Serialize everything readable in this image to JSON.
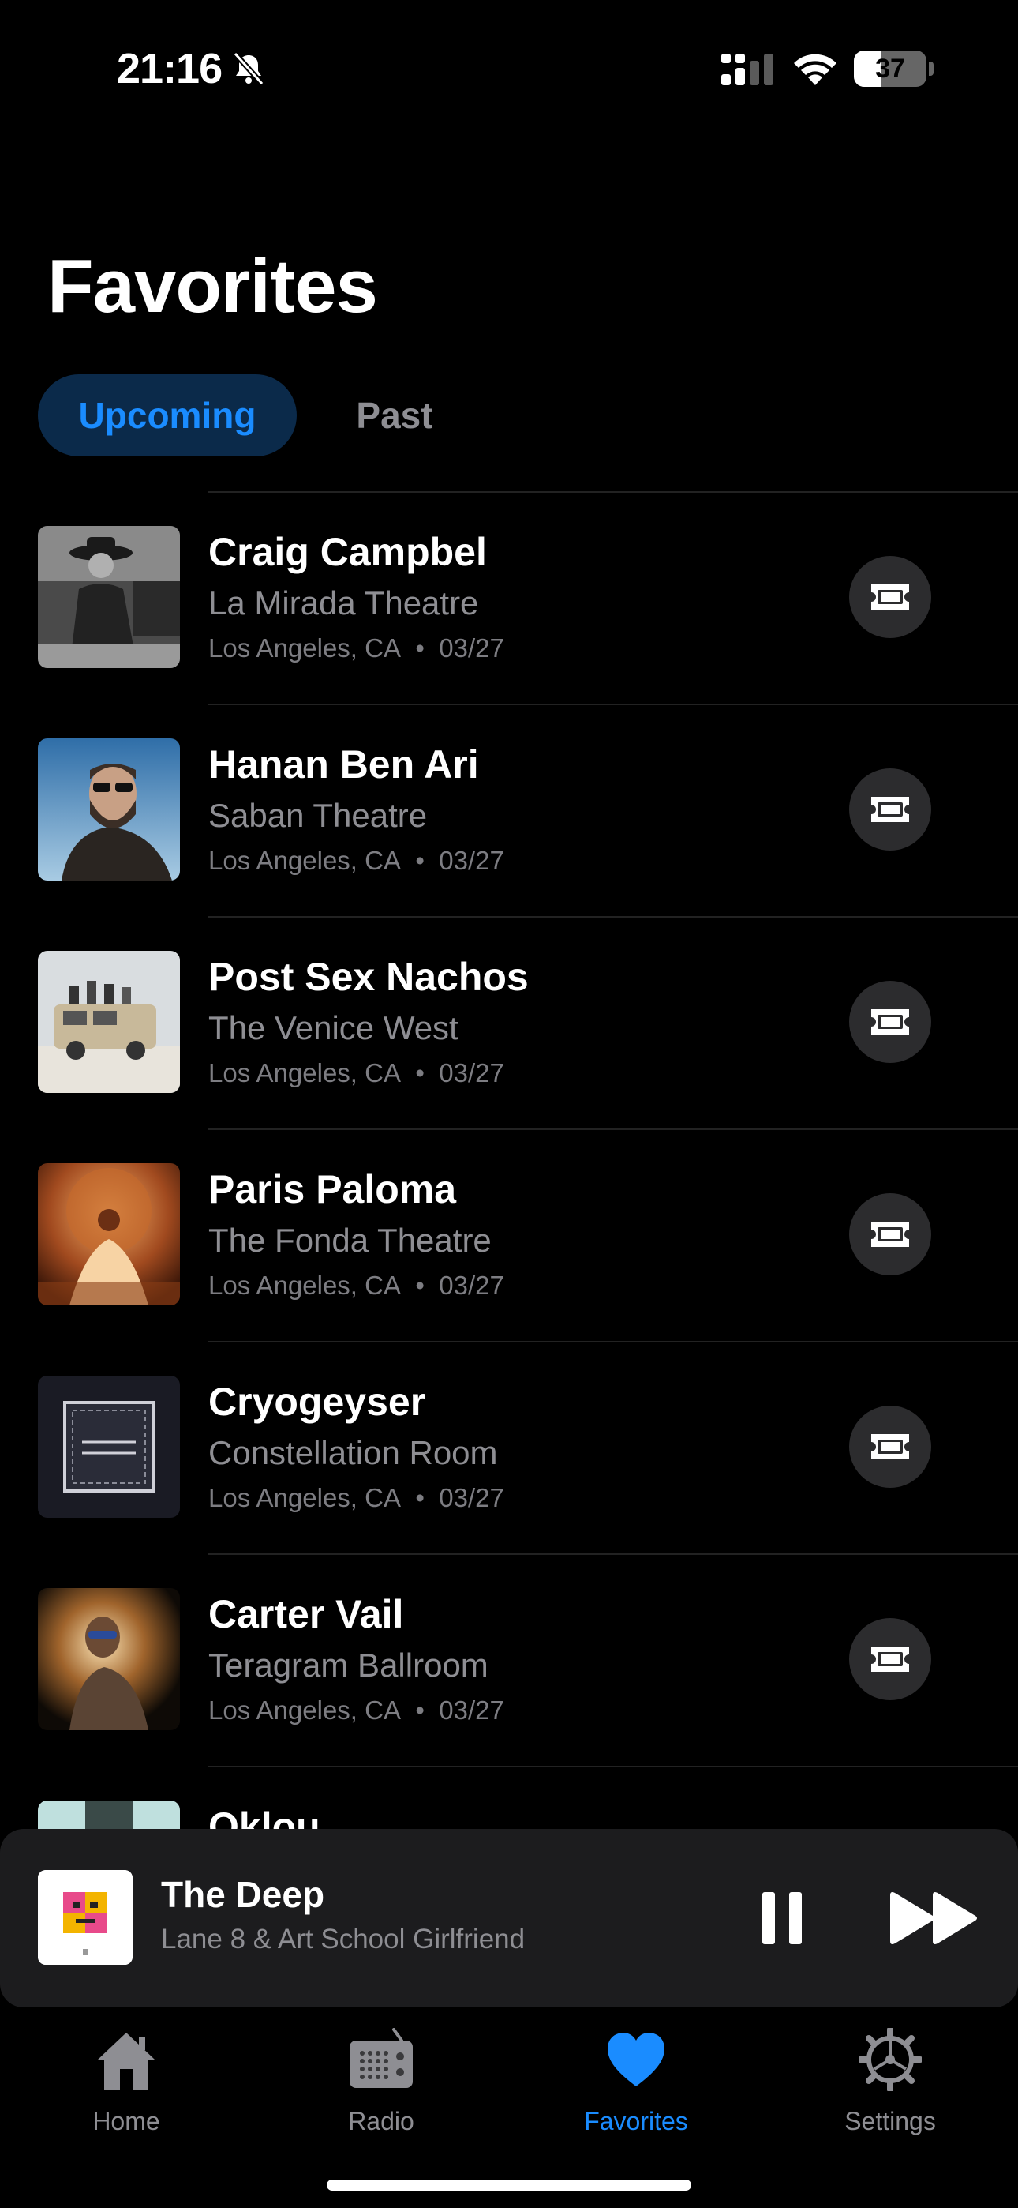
{
  "status": {
    "time": "21:16",
    "battery": "37",
    "battery_level": 0.37,
    "icons": [
      "bell-slash-icon",
      "cellular-signal-icon",
      "wifi-icon",
      "battery-icon"
    ]
  },
  "page": {
    "title": "Favorites"
  },
  "tabs": {
    "upcoming": "Upcoming",
    "past": "Past",
    "selected": "Upcoming"
  },
  "events": [
    {
      "artist": "Craig Campbel",
      "venue": "La Mirada Theatre",
      "location": "Los Angeles, CA",
      "date": "03/27"
    },
    {
      "artist": "Hanan Ben Ari",
      "venue": "Saban Theatre",
      "location": "Los Angeles, CA",
      "date": "03/27"
    },
    {
      "artist": "Post Sex Nachos",
      "venue": "The Venice West",
      "location": "Los Angeles, CA",
      "date": "03/27"
    },
    {
      "artist": "Paris Paloma",
      "venue": "The Fonda Theatre",
      "location": "Los Angeles, CA",
      "date": "03/27"
    },
    {
      "artist": "Cryogeyser",
      "venue": "Constellation Room",
      "location": "Los Angeles, CA",
      "date": "03/27"
    },
    {
      "artist": "Carter Vail",
      "venue": "Teragram Ballroom",
      "location": "Los Angeles, CA",
      "date": "03/27"
    },
    {
      "artist": "Oklou",
      "venue": "",
      "location": "",
      "date": ""
    }
  ],
  "meta_separator": "•",
  "player": {
    "title": "The Deep",
    "artist": "Lane 8 & Art School Girlfriend",
    "state": "playing"
  },
  "tabbar": {
    "items": [
      {
        "label": "Home",
        "icon": "house-icon"
      },
      {
        "label": "Radio",
        "icon": "radio-icon"
      },
      {
        "label": "Favorites",
        "icon": "heart-icon"
      },
      {
        "label": "Settings",
        "icon": "gear-icon"
      }
    ],
    "active": "Favorites"
  },
  "colors": {
    "accent": "#1a8cff",
    "background": "#000000",
    "secondary_text": "#8e8e93",
    "surface": "#1c1c1e",
    "selected_tab_bg": "#0b2a4a"
  }
}
